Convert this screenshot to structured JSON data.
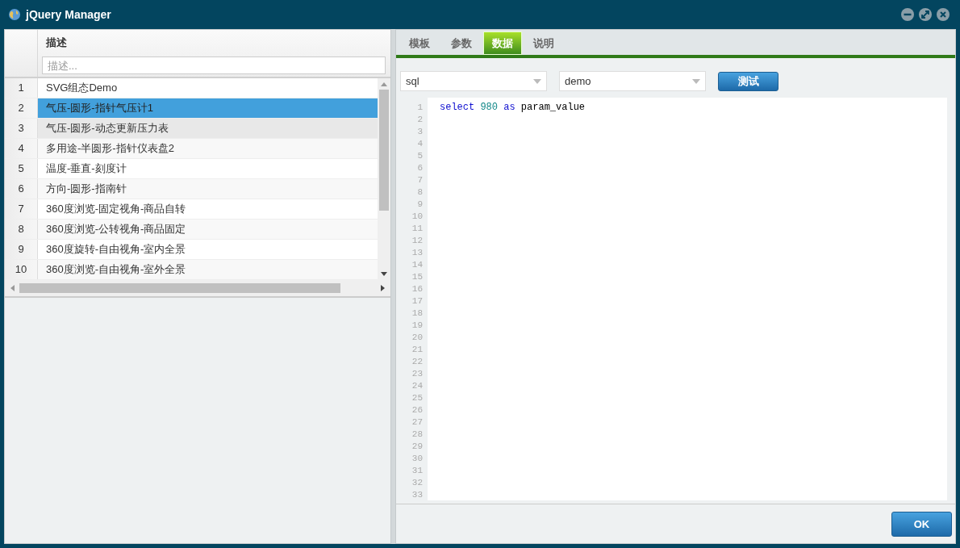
{
  "window": {
    "title": "jQuery Manager"
  },
  "grid": {
    "column": "描述",
    "filter": {
      "placeholder": "描述..."
    },
    "rows": [
      {
        "num": "1",
        "text": "SVG组态Demo",
        "selected": false,
        "hovered": false
      },
      {
        "num": "2",
        "text": "气压-圆形-指针气压计1",
        "selected": true,
        "hovered": false
      },
      {
        "num": "3",
        "text": "气压-圆形-动态更新压力表",
        "selected": false,
        "hovered": true
      },
      {
        "num": "4",
        "text": "多用途-半圆形-指针仪表盘2",
        "selected": false,
        "hovered": false
      },
      {
        "num": "5",
        "text": "温度-垂直-刻度计",
        "selected": false,
        "hovered": false
      },
      {
        "num": "6",
        "text": "方向-圆形-指南针",
        "selected": false,
        "hovered": false
      },
      {
        "num": "7",
        "text": "360度浏览-固定视角-商品自转",
        "selected": false,
        "hovered": false
      },
      {
        "num": "8",
        "text": "360度浏览-公转视角-商品固定",
        "selected": false,
        "hovered": false
      },
      {
        "num": "9",
        "text": "360度旋转-自由视角-室内全景",
        "selected": false,
        "hovered": false
      },
      {
        "num": "10",
        "text": "360度浏览-自由视角-室外全景",
        "selected": false,
        "hovered": false
      }
    ]
  },
  "tabs": [
    {
      "label": "模板",
      "selected": false
    },
    {
      "label": "参数",
      "selected": false
    },
    {
      "label": "数据",
      "selected": true
    },
    {
      "label": "说明",
      "selected": false
    }
  ],
  "toolbar": {
    "type_select": "sql",
    "source_select": "demo",
    "test_button": "测试"
  },
  "editor": {
    "line_numbers": [
      "1",
      "2",
      "3",
      "4",
      "5",
      "6",
      "7",
      "8",
      "9",
      "10",
      "11",
      "12",
      "13",
      "14",
      "15",
      "16",
      "17",
      "18",
      "19",
      "20",
      "21",
      "22",
      "23",
      "24",
      "25",
      "26",
      "27",
      "28",
      "29",
      "30",
      "31",
      "32",
      "33"
    ],
    "code": [
      {
        "kind": "keyword",
        "text": "select"
      },
      {
        "kind": "number",
        "text": "980"
      },
      {
        "kind": "keyword",
        "text": "as"
      },
      {
        "kind": "plain",
        "text": "param_value"
      }
    ]
  },
  "ok_button": "OK"
}
